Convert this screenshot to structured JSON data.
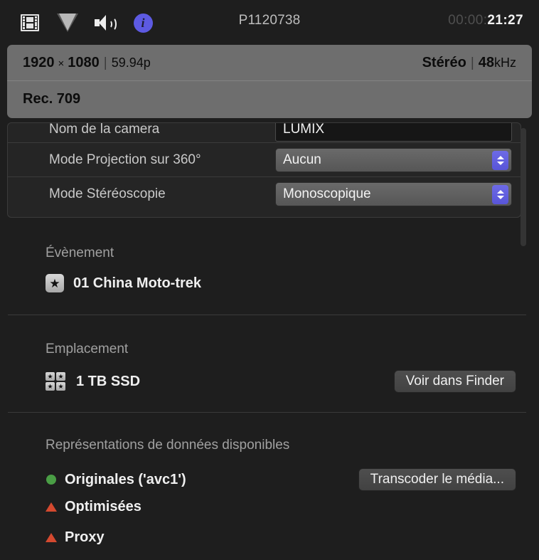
{
  "toolbar": {
    "icons": [
      {
        "name": "film-strip-icon",
        "label": "Vidéo"
      },
      {
        "name": "triangle-down-icon",
        "label": "Couleur"
      },
      {
        "name": "speaker-icon",
        "label": "Audio"
      },
      {
        "name": "info-circle-icon",
        "label": "Infos"
      }
    ],
    "title": "P1120738",
    "timecode_dim": "00:00:",
    "timecode_active": "21:27"
  },
  "summary": {
    "width": "1920",
    "times": "×",
    "height": "1080",
    "divider": "|",
    "framerate": "59.94p",
    "audio_channels": "Stéréo",
    "audio_divider": "|",
    "sample_rate_num": "48",
    "sample_rate_unit": "kHz",
    "color_space": "Rec. 709"
  },
  "form": {
    "rows": [
      {
        "label": "Nom de la camera",
        "type": "textfield",
        "value": "LUMIX"
      },
      {
        "label": "Mode Projection sur 360°",
        "type": "popup",
        "value": "Aucun"
      },
      {
        "label": "Mode Stéréoscopie",
        "type": "popup",
        "value": "Monoscopique"
      }
    ]
  },
  "event_section": {
    "title": "Évènement",
    "icon": "star-icon",
    "icon_glyph": "★",
    "value": "01 China Moto-trek"
  },
  "location_section": {
    "title": "Emplacement",
    "icon": "library-icon",
    "icon_glyph": "★",
    "value": "1 TB SSD",
    "button": "Voir dans Finder"
  },
  "media_section": {
    "title": "Représentations de données disponibles",
    "button": "Transcoder le média...",
    "items": [
      {
        "label": "Originales ('avc1')",
        "status": "available",
        "marker": "dot",
        "color": "#4a9e45"
      },
      {
        "label": "Optimisées",
        "status": "missing",
        "marker": "triangle",
        "color": "#d4492f"
      },
      {
        "label": "Proxy",
        "status": "missing",
        "marker": "triangle",
        "color": "#d4492f"
      }
    ]
  },
  "colors": {
    "accent_blue": "#5d5ae2",
    "background": "#1e1e1e",
    "summary_panel": "#6e6e6e",
    "status_green": "#4a9e45",
    "status_red": "#d4492f"
  }
}
